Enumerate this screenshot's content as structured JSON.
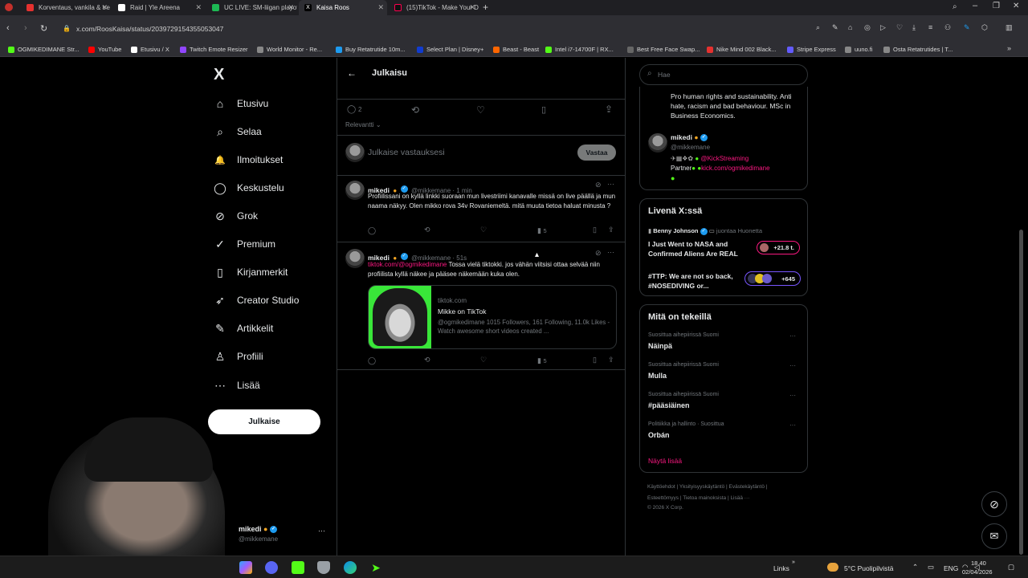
{
  "browser": {
    "tabs": [
      {
        "title": "Korventaus, vankila & tre",
        "color": "#e5312f"
      },
      {
        "title": "Raid | Yle Areena",
        "color": "#ffffff"
      },
      {
        "title": "UC LIVE: SM-liigan playof",
        "color": "#1db954"
      },
      {
        "title": "Kaisa Roos",
        "color": "#ffffff"
      },
      {
        "title": "(15)TikTok - Make Your D",
        "color": "#ffffff"
      }
    ],
    "url": "x.com/RoosKaisa/status/2039729154355053047",
    "bookmarks": [
      {
        "label": "OGMIKEDIMANE Str...",
        "color": "#53fc18"
      },
      {
        "label": "YouTube",
        "color": "#ff0000"
      },
      {
        "label": "Etusivu / X",
        "color": "#ffffff"
      },
      {
        "label": "Twitch Emote Resizer",
        "color": "#9146ff"
      },
      {
        "label": "World Monitor - Re...",
        "color": "#888888"
      },
      {
        "label": "Buy Retatrutide 10m...",
        "color": "#1d9bf0"
      },
      {
        "label": "Select Plan | Disney+",
        "color": "#113ccf"
      },
      {
        "label": "Beast - Beast",
        "color": "#ff6600"
      },
      {
        "label": "Intel i7-14700F | RX...",
        "color": "#53fc18"
      },
      {
        "label": "Best Free Face Swap...",
        "color": "#666666"
      },
      {
        "label": "Nike Mind 002 Black...",
        "color": "#e5312f"
      },
      {
        "label": "Stripe Express",
        "color": "#635bff"
      },
      {
        "label": "uuno.fi",
        "color": "#888888"
      },
      {
        "label": "Osta Retatrutides | T...",
        "color": "#888888"
      }
    ]
  },
  "sidebar": {
    "logo": "X",
    "items": [
      {
        "label": "Etusivu",
        "icon": "⌂"
      },
      {
        "label": "Selaa",
        "icon": "⌕"
      },
      {
        "label": "Ilmoitukset",
        "icon": "🔔"
      },
      {
        "label": "Keskustelu",
        "icon": "◯"
      },
      {
        "label": "Grok",
        "icon": "⊘"
      },
      {
        "label": "Premium",
        "icon": "✓"
      },
      {
        "label": "Kirjanmerkit",
        "icon": "▯"
      },
      {
        "label": "Creator Studio",
        "icon": "➶"
      },
      {
        "label": "Artikkelit",
        "icon": "✎"
      },
      {
        "label": "Profiili",
        "icon": "♙"
      },
      {
        "label": "Lisää",
        "icon": "⋯"
      }
    ],
    "post_label": "Julkaise",
    "account": {
      "name": "mikedi",
      "handle": "@mikkemane"
    }
  },
  "center": {
    "header": "Julkaisu",
    "stats": {
      "replies": "2"
    },
    "sort_label": "Relevantti",
    "reply_placeholder": "Julkaise vastauksesi",
    "reply_button": "Vastaa",
    "tweets": [
      {
        "name": "mikedi",
        "meta": "@mikkemane · 1 min",
        "text": "Profiilissani on kyllä linkki suoraan mun livestriimi kanavalle missä on live päällä ja mun naama näkyy. Olen mikko rova 34v Rovaniemeltä. mitä muuta tietoa haluat minusta ?",
        "views": "5"
      },
      {
        "name": "mikedi",
        "meta": "@mikkemane · 51s",
        "link": "tiktok.com/@ogmikedimane",
        "text": " Tossa vielä tiktokki. jos vähän viitsisi ottaa selvää niin profiilista kyllä näkee ja pääsee näkemään kuka olen.",
        "views": "5",
        "card": {
          "domain": "tiktok.com",
          "title": "Mikke on TikTok",
          "desc": "@ogmikedimane 1015 Followers, 161 Following, 11.0k Likes - Watch awesome short videos created ..."
        }
      }
    ]
  },
  "right": {
    "search_placeholder": "Hae",
    "profile_bio": "Pro human rights and sustainability. Anti hate, racism and bad behaviour. MSc in Business Economics.",
    "profile2": {
      "name": "mikedi",
      "handle": "@mikkemane",
      "bio_link": "@KickStreaming",
      "partner": "Partner",
      "partner_link": "kick.com/ogmikedimane"
    },
    "live": {
      "title": "Livenä X:ssä",
      "items": [
        {
          "host": "Benny Johnson",
          "role": "juontaa Huonetta",
          "title": "I Just Went to NASA and Confirmed Aliens Are REAL",
          "count": "+21.8 t."
        },
        {
          "title": "#TTP: We are not so back, #NOSEDIVING or...",
          "count": "+645"
        }
      ]
    },
    "trends": {
      "title": "Mitä on tekeillä",
      "items": [
        {
          "cat": "Suosittua aihepiirissä Suomi",
          "name": "Näinpä"
        },
        {
          "cat": "Suosittua aihepiirissä Suomi",
          "name": "Mulla"
        },
        {
          "cat": "Suosittua aihepiirissä Suomi",
          "name": "#pääsiäinen"
        },
        {
          "cat": "Politiikka ja hallinto · Suosittua",
          "name": "Orbán"
        }
      ],
      "show_more": "Näytä lisää"
    },
    "footer": {
      "line1": "Käyttöehdot | Yksityisyyskäytäntö | Evästekäytäntö |",
      "line2": "Esteettömyys | Tietoa mainoksista | Lisää ···",
      "line3": "© 2026 X Corp."
    }
  },
  "taskbar": {
    "links": "Links",
    "weather": "5°C Puolipilvistä",
    "lang": "ENG",
    "time": "18.40",
    "date": "02/04/2026"
  }
}
